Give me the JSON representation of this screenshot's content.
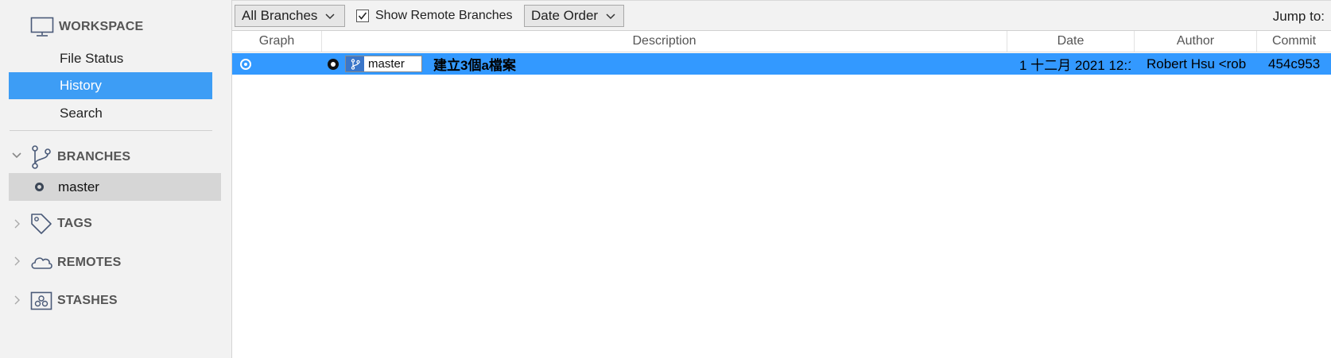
{
  "sidebar": {
    "workspace": {
      "title": "WORKSPACE",
      "items": [
        {
          "label": "File Status"
        },
        {
          "label": "History"
        },
        {
          "label": "Search"
        }
      ]
    },
    "branches": {
      "title": "BRANCHES",
      "items": [
        {
          "label": "master"
        }
      ]
    },
    "tags": {
      "title": "TAGS"
    },
    "remotes": {
      "title": "REMOTES"
    },
    "stashes": {
      "title": "STASHES"
    }
  },
  "toolbar": {
    "branches_dropdown": "All Branches",
    "show_remote_label": "Show Remote Branches",
    "show_remote_checked": true,
    "order_dropdown": "Date Order",
    "jump_to_label": "Jump to:"
  },
  "table": {
    "columns": [
      "Graph",
      "Description",
      "Date",
      "Author",
      "Commit"
    ],
    "rows": [
      {
        "branch": "master",
        "description": "建立3個a檔案",
        "date": "1 十二月 2021 12:1",
        "author": "Robert Hsu <rob",
        "commit": "454c953"
      }
    ]
  },
  "colors": {
    "selection_blue": "#3399ff",
    "sidebar_selected": "#3d9df5",
    "branch_icon_bg": "#3a76c9"
  }
}
